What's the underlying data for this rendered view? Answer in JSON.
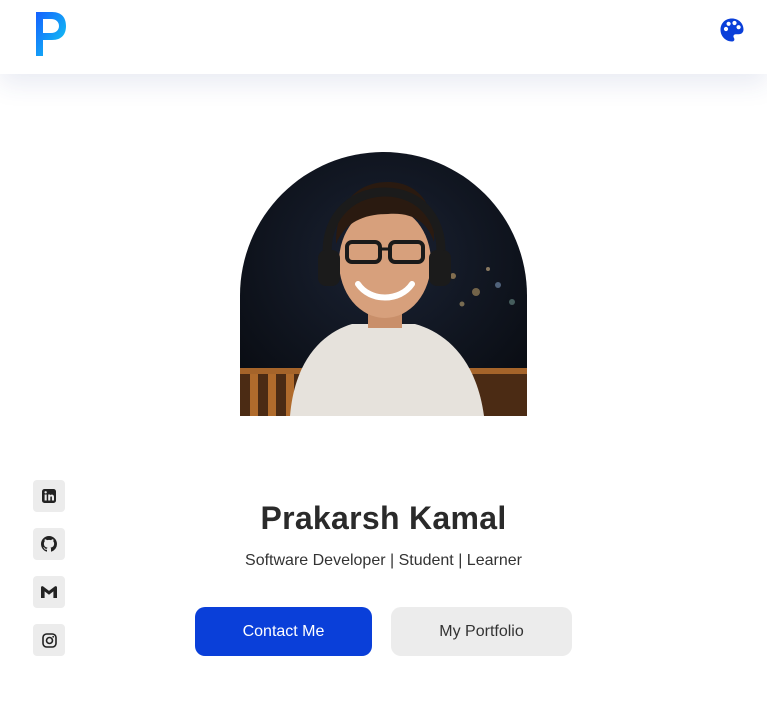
{
  "brand": {
    "logo_letter": "P",
    "accent": "#0a3fd9",
    "logo_gradient": [
      "#1560ff",
      "#12d0f0"
    ]
  },
  "header": {
    "theme_icon": "palette-icon"
  },
  "hero": {
    "photo_alt": "Prakarsh Kamal",
    "name": "Prakarsh Kamal",
    "tagline": "Software Developer | Student | Learner",
    "primary_button": "Contact Me",
    "secondary_button": "My Portfolio"
  },
  "social_links": [
    {
      "icon": "linkedin-icon",
      "label": "LinkedIn"
    },
    {
      "icon": "github-icon",
      "label": "GitHub"
    },
    {
      "icon": "gmail-icon",
      "label": "Gmail"
    },
    {
      "icon": "instagram-icon",
      "label": "Instagram"
    }
  ]
}
